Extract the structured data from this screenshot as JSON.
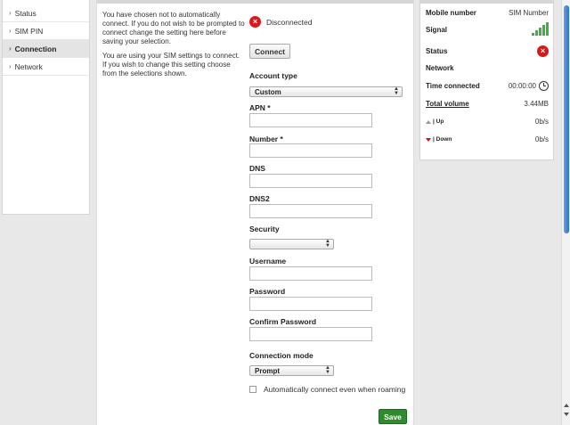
{
  "nav": {
    "items": [
      {
        "label": "Status",
        "active": false
      },
      {
        "label": "SIM PIN",
        "active": false
      },
      {
        "label": "Connection",
        "active": true
      },
      {
        "label": "Network",
        "active": false
      }
    ]
  },
  "intro": {
    "p1": "You have chosen not to automatically connect. If you do not wish to be prompted to connect change the setting here before saving your selection.",
    "p2": "You are using your SIM settings to connect. If you wish to change this setting choose from the selections shown."
  },
  "connection": {
    "status": "Disconnected",
    "connect_label": "Connect"
  },
  "form": {
    "account_type_label": "Account type",
    "account_type_value": "Custom",
    "apn_label": "APN *",
    "apn_value": "",
    "number_label": "Number *",
    "number_value": "",
    "dns_label": "DNS",
    "dns_value": "",
    "dns2_label": "DNS2",
    "dns2_value": "",
    "security_label": "Security",
    "security_value": "",
    "username_label": "Username",
    "username_value": "",
    "password_label": "Password",
    "password_value": "",
    "confirm_password_label": "Confirm Password",
    "confirm_password_value": "",
    "connection_mode_label": "Connection mode",
    "connection_mode_value": "Prompt",
    "roaming_label": "Automatically connect even when roaming",
    "save_label": "Save"
  },
  "info": {
    "mobile_number_label": "Mobile number",
    "mobile_number_value": "SIM Number",
    "signal_label": "Signal",
    "signal_bars": 5,
    "status_label": "Status",
    "network_label": "Network",
    "time_connected_label": "Time connected",
    "time_connected_value": "00:00:00",
    "total_volume_label": "Total volume",
    "total_volume_value": "3.44MB",
    "up_label": "| Up",
    "up_value": "0b/s",
    "down_label": "| Down",
    "down_value": "0b/s"
  },
  "colors": {
    "disconnected": "#d7191c",
    "signal": "#3cb043",
    "save": "#2e8b2e"
  }
}
